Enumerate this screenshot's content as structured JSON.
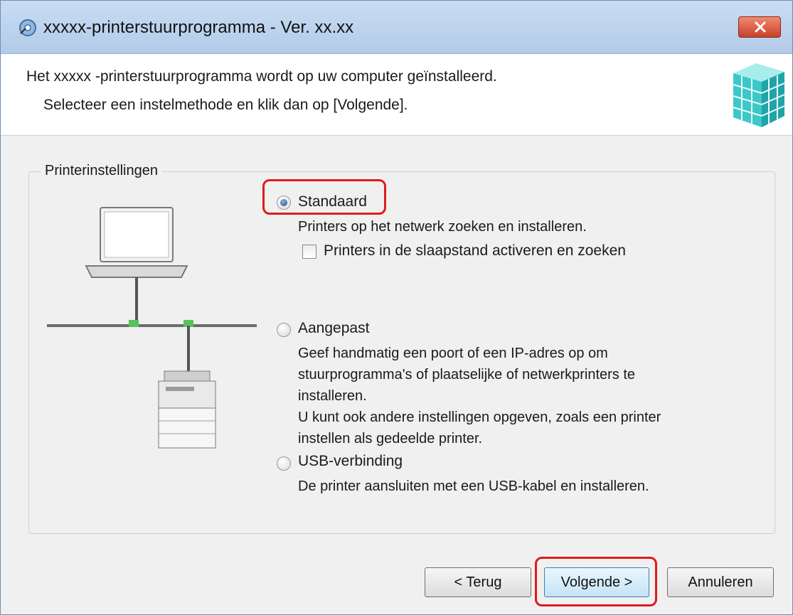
{
  "window": {
    "title": "xxxxx-printerstuurprogramma - Ver. xx.xx"
  },
  "header": {
    "line1": "Het xxxxx -printerstuurprogramma wordt op uw computer geïnstalleerd.",
    "line2": "Selecteer een instelmethode en klik dan op [Volgende]."
  },
  "group": {
    "label": "Printerinstellingen",
    "options": [
      {
        "label": "Standaard",
        "selected": true,
        "description": [
          "Printers op het netwerk zoeken en installeren."
        ],
        "checkbox": {
          "label": "Printers in de slaapstand activeren en zoeken",
          "checked": false
        }
      },
      {
        "label": "Aangepast",
        "selected": false,
        "description": [
          "Geef handmatig een poort of een IP-adres op om",
          "stuurprogramma's of plaatselijke of netwerkprinters te",
          "installeren.",
          "U kunt ook andere instellingen opgeven, zoals een printer",
          "instellen als gedeelde printer."
        ]
      },
      {
        "label": "USB-verbinding",
        "selected": false,
        "description": [
          "De printer aansluiten met een USB-kabel en installeren."
        ]
      }
    ]
  },
  "buttons": {
    "back": "< Terug",
    "next": "Volgende >",
    "cancel": "Annuleren"
  },
  "colors": {
    "highlight": "#e01b1b",
    "titlebar": "#bcd3ee",
    "logo": "#3cc8c8"
  }
}
